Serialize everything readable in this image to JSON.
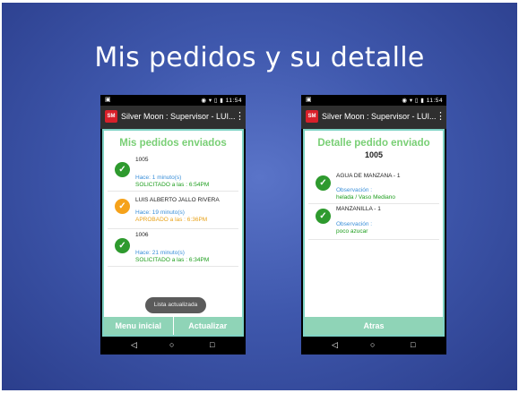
{
  "slide": {
    "title": "Mis pedidos y su detalle"
  },
  "status_bar": {
    "icons": "◉ ▾ ▯ ▮",
    "time": "11:54",
    "left_icon": "▣"
  },
  "app_bar": {
    "logo_text": "SM",
    "title": "Silver Moon : Supervisor - LUI...",
    "menu_icon": "⋮"
  },
  "nav_bar": {
    "back": "◁",
    "home": "○",
    "recent": "□"
  },
  "screen1": {
    "title": "Mis pedidos enviados",
    "orders": [
      {
        "title": "1005",
        "ago": "Hace: 1 minuto(s)",
        "status": "SOLICITADO a las :  6:54PM",
        "state": "green"
      },
      {
        "title": "LUIS ALBERTO JALLO RIVERA",
        "ago": "Hace: 19 minuto(s)",
        "status": "APROBADO a las :  6:36PM",
        "state": "orange"
      },
      {
        "title": "1006",
        "ago": "Hace: 21 minuto(s)",
        "status": "SOLICITADO a las :  6:34PM",
        "state": "green"
      }
    ],
    "toast": "Lista actualizada",
    "buttons": {
      "menu": "Menu inicial",
      "refresh": "Actualizar"
    }
  },
  "screen2": {
    "title": "Detalle pedido enviado",
    "subtitle": "1005",
    "items": [
      {
        "title": "AGUA DE MANZANA - 1",
        "obs_label": "Observación :",
        "obs": "helada / Vaso Mediano"
      },
      {
        "title": "MANZANILLA - 1",
        "obs_label": "Observación :",
        "obs": "poco azucar"
      }
    ],
    "buttons": {
      "back": "Atras"
    }
  },
  "colors": {
    "accent": "#79cf75",
    "button": "#8fd4b7",
    "check_green": "#2e9a2e",
    "check_orange": "#f5a21b"
  },
  "icons": {
    "check": "check-icon",
    "menu": "overflow-menu-icon"
  }
}
